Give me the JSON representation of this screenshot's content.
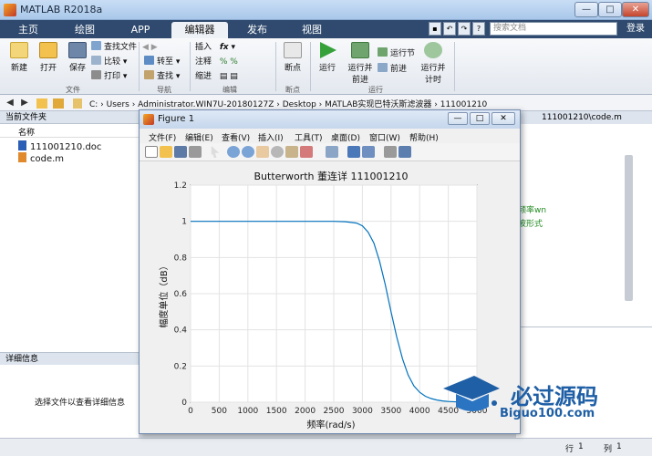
{
  "window": {
    "title": "MATLAB R2018a",
    "min": "—",
    "max": "□",
    "close": "✕"
  },
  "tabs": [
    "主页",
    "绘图",
    "APP",
    "编辑器",
    "发布",
    "视图"
  ],
  "search": {
    "placeholder": "搜索文档"
  },
  "login": "登录",
  "ribbon": {
    "new": "新建",
    "open": "打开",
    "save": "保存",
    "find_files": "查找文件",
    "compare": "比较",
    "print": "打印",
    "goto": "转至",
    "find": "查找",
    "insert": "插入",
    "comment": "注释",
    "indent": "缩进",
    "breakpoint": "断点",
    "run": "运行",
    "run_advance": "运行并\n前进",
    "run_section": "运行节",
    "advance": "前进",
    "run_time": "运行并\n计时",
    "groups": [
      "文件",
      "导航",
      "编辑",
      "断点",
      "运行"
    ]
  },
  "address": {
    "path": "C: › Users › Administrator.WIN7U-20180127Z › Desktop › MATLAB实现巴特沃斯滤波器 › 111001210"
  },
  "left": {
    "header": "当前文件夹",
    "column": "名称",
    "files": [
      "111001210.doc",
      "code.m"
    ],
    "detail_header": "详细信息",
    "detail_msg": "选择文件以查看详细信息"
  },
  "editor": {
    "header": "111001210\\code.m",
    "line1": "频率wn",
    "line2": "波形式"
  },
  "status": {
    "row_label": "行",
    "row": "1",
    "col_label": "列",
    "col": "1"
  },
  "figure": {
    "title": "Figure 1",
    "menu": [
      "文件(F)",
      "编辑(E)",
      "查看(V)",
      "插入(I)",
      "工具(T)",
      "桌面(D)",
      "窗口(W)",
      "帮助(H)"
    ]
  },
  "chart_data": {
    "type": "line",
    "title": "Butterworth   董连详 111001210",
    "xlabel": "频率(rad/s)",
    "ylabel": "幅度单位（dB）",
    "xlim": [
      0,
      5000
    ],
    "ylim": [
      0,
      1.2
    ],
    "xticks": [
      0,
      500,
      1000,
      1500,
      2000,
      2500,
      3000,
      3500,
      4000,
      4500,
      5000
    ],
    "yticks": [
      0,
      0.2,
      0.4,
      0.6,
      0.8,
      1.0,
      1.2
    ],
    "ytick_labels": [
      "0",
      "0.2",
      "0.4",
      "0.6",
      "0.8",
      "1",
      "1.2"
    ],
    "grid": true,
    "series": [
      {
        "color": "#0072bd",
        "x": [
          0,
          500,
          1000,
          1500,
          2000,
          2500,
          2700,
          2900,
          3000,
          3100,
          3200,
          3300,
          3400,
          3500,
          3600,
          3700,
          3800,
          3900,
          4000,
          4100,
          4200,
          4300,
          4400,
          4500,
          4700,
          5000
        ],
        "y": [
          1,
          1,
          1,
          1,
          1,
          1,
          0.998,
          0.99,
          0.975,
          0.94,
          0.88,
          0.78,
          0.65,
          0.5,
          0.36,
          0.24,
          0.15,
          0.09,
          0.055,
          0.033,
          0.02,
          0.012,
          0.007,
          0.004,
          0.001,
          0
        ]
      }
    ]
  },
  "watermark": {
    "text": "必过源码",
    "url": "Biguo100.com"
  }
}
